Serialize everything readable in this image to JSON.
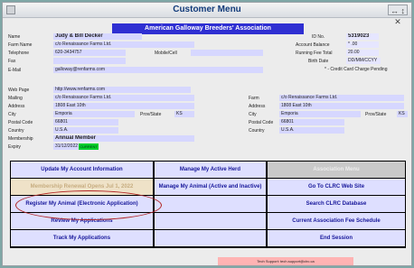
{
  "window": {
    "title": "Customer Menu",
    "controls": "↔ ↕ ✕"
  },
  "association": "American Galloway Breeders' Association",
  "account": {
    "name_label": "Name",
    "name": "Judy & Bill Decker",
    "farm_label": "Farm Name",
    "farm": "c/o Renaissance Farms Ltd.",
    "telephone_label": "Telephone",
    "telephone": "620-3434757",
    "mobile_label": "Mobile/Cell",
    "mobile": "",
    "fax_label": "Fax",
    "fax": "",
    "email_label": "E-Mail",
    "email": "galloway@renfarms.com",
    "id_label": "ID No.",
    "id": "5319023",
    "balance_label": "Account Balance",
    "balance": "* .00",
    "fee_label": "Running Fee Total",
    "fee": "20.00",
    "birth_label": "Birth Date",
    "birth": "DD/MM/CCYY",
    "credit_note": "* - Credit Card Charge Pending"
  },
  "address": {
    "web_label": "Web Page",
    "web": "http://www.renfarms.com",
    "mailing_label": "Mailing",
    "mailing": "c/o Renaissance Farms Ltd.",
    "address_label": "Address",
    "address": "1808 East 10th",
    "city_label": "City",
    "city": "Emporia",
    "prov_label": "Prov/State",
    "prov": "KS",
    "postal_label": "Postal Code",
    "postal": "66801",
    "country_label": "Country",
    "country": "U.S.A.",
    "membership_label": "Membership",
    "membership": "Annual Member",
    "expiry_label": "Expiry",
    "expiry": "31/12/2022",
    "status": "CURRENT"
  },
  "farm_address": {
    "farm_label": "Farm",
    "farm": "c/o Renaissance Farms Ltd.",
    "address_label": "Address",
    "address": "1808 East 10th",
    "city_label": "City",
    "city": "Emporia",
    "prov_label": "Prov/State",
    "prov": "KS",
    "postal_label": "Postal Code",
    "postal": "66801",
    "country_label": "Country",
    "country": "U.S.A."
  },
  "buttons": {
    "update_account": "Update My Account Information",
    "manage_herd": "Manage My Active Herd",
    "association_menu": "Association Menu",
    "membership_renewal": "Membership Renewal Opens Jul 1, 2022",
    "manage_animals": "Manage My Animal (Active and Inactive)",
    "clrc_website": "Go To CLRC Web Site",
    "register_animal": "Register My Animal (Electronic Application)",
    "search_database": "Search CLRC Database",
    "review_applications": "Review My Applications",
    "fee_schedule": "Current Association Fee Schedule",
    "track_applications": "Track My Applications",
    "end_session": "End Session"
  },
  "support": "Tech Support: tech.support@clrc.ca",
  "colors": {
    "background": "#7fa7a6",
    "field": "#d6d7ff",
    "header": "#2f2fd2",
    "button": "#dedfff",
    "button_text": "#17179a",
    "status_current": "#00d02d",
    "highlight_oval": "#b12424"
  }
}
